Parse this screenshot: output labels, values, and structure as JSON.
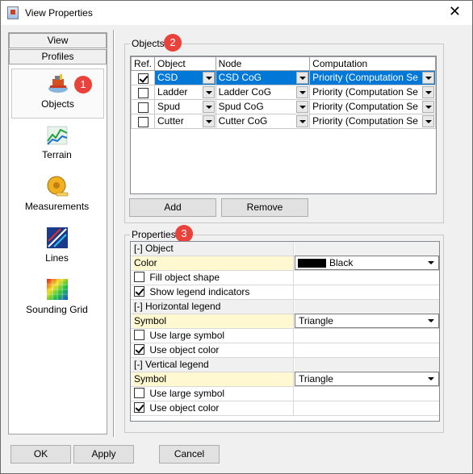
{
  "window": {
    "title": "View Properties",
    "close_glyph": "✕"
  },
  "nav": {
    "sections": [
      "View",
      "Profiles"
    ],
    "items": [
      {
        "label": "Objects",
        "icon": "dredger-icon",
        "selected": true
      },
      {
        "label": "Terrain",
        "icon": "terrain-icon"
      },
      {
        "label": "Measurements",
        "icon": "tape-measure-icon"
      },
      {
        "label": "Lines",
        "icon": "lines-icon"
      },
      {
        "label": "Sounding Grid",
        "icon": "sounding-grid-icon"
      }
    ]
  },
  "badges": [
    "1",
    "2",
    "3"
  ],
  "objects": {
    "group_title": "Objects",
    "columns": [
      "Ref.",
      "Object",
      "Node",
      "Computation"
    ],
    "rows": [
      {
        "ref": true,
        "object": "CSD",
        "node": "CSD CoG",
        "computation": "Priority (Computation Se",
        "selected": true
      },
      {
        "ref": false,
        "object": "Ladder",
        "node": "Ladder CoG",
        "computation": "Priority (Computation Se"
      },
      {
        "ref": false,
        "object": "Spud",
        "node": "Spud CoG",
        "computation": "Priority (Computation Se"
      },
      {
        "ref": false,
        "object": "Cutter",
        "node": "Cutter CoG",
        "computation": "Priority (Computation Se"
      }
    ],
    "add_label": "Add",
    "remove_label": "Remove"
  },
  "properties": {
    "group_title": "Properties",
    "object_cat": "[-] Object",
    "color_label": "Color",
    "color_value": "Black",
    "fill_shape": "Fill object shape",
    "show_legend": "Show legend indicators",
    "hlegend_cat": "[-] Horizontal legend",
    "h_symbol_label": "Symbol",
    "h_symbol_value": "Triangle",
    "h_large": "Use large symbol",
    "h_objcolor": "Use object color",
    "vlegend_cat": "[-] Vertical legend",
    "v_symbol_label": "Symbol",
    "v_symbol_value": "Triangle",
    "v_large": "Use large symbol",
    "v_objcolor": "Use object color"
  },
  "footer": {
    "ok_label": "OK",
    "apply_label": "Apply",
    "cancel_label": "Cancel"
  },
  "colors": {
    "accent": "#0078d7",
    "badge": "#e8423b",
    "highlight": "#fff8d0"
  }
}
